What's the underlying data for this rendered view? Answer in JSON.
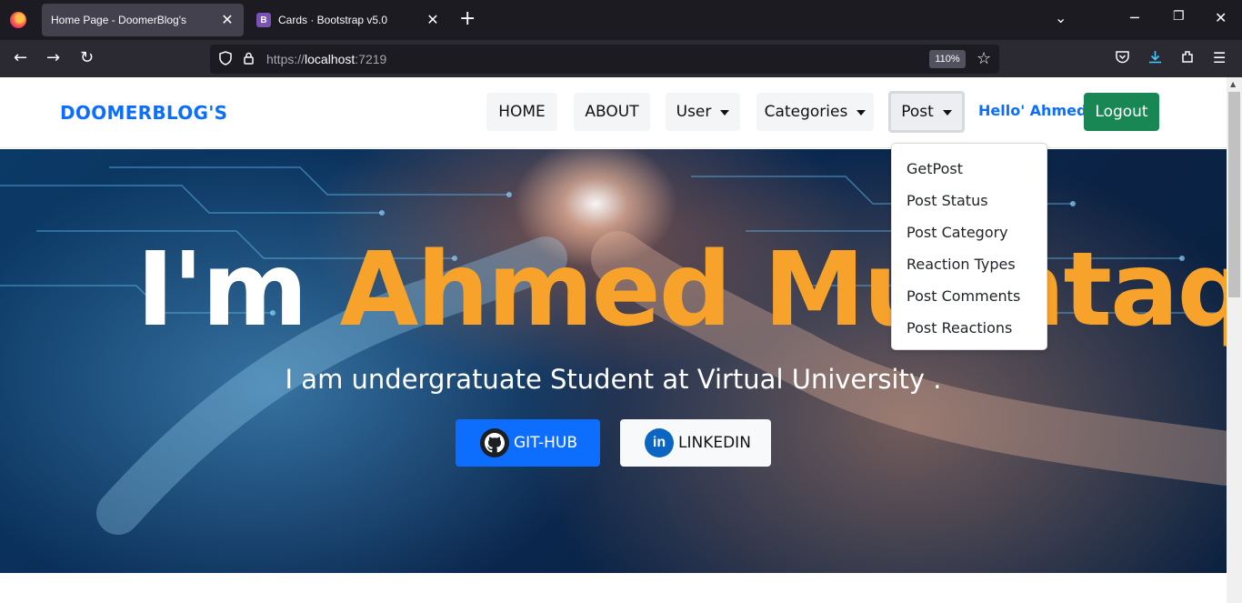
{
  "browser": {
    "tabs": [
      {
        "title": "Home Page - DoomerBlog's",
        "favicon": "page-icon",
        "active": true
      },
      {
        "title": "Cards · Bootstrap v5.0",
        "favicon": "bootstrap-icon",
        "favicon_text": "B",
        "active": false
      }
    ],
    "url_prefix": "https://",
    "url_host": "localhost",
    "url_port": ":7219",
    "zoom": "110%"
  },
  "site": {
    "brand": "DOOMERBLOG'S",
    "nav": {
      "home": "HOME",
      "about": "ABOUT",
      "user": "User",
      "categories": "Categories",
      "post": "Post"
    },
    "greeting": "Hello' Ahmed",
    "logout": "Logout",
    "post_menu": [
      "GetPost",
      "Post Status",
      "Post Category",
      "Reaction Types",
      "Post Comments",
      "Post Reactions"
    ]
  },
  "hero": {
    "intro": "I'm",
    "name": "Ahmed Mushtaq",
    "subtitle": "I am undergratuate Student at Virtual University .",
    "github_button": "GIT-HUB",
    "linkedin_button": "LINKEDIN",
    "linkedin_icon_text": "in"
  },
  "colors": {
    "brand_blue": "#0d6efd",
    "success_green": "#198754",
    "name_orange": "#f7a32b"
  }
}
